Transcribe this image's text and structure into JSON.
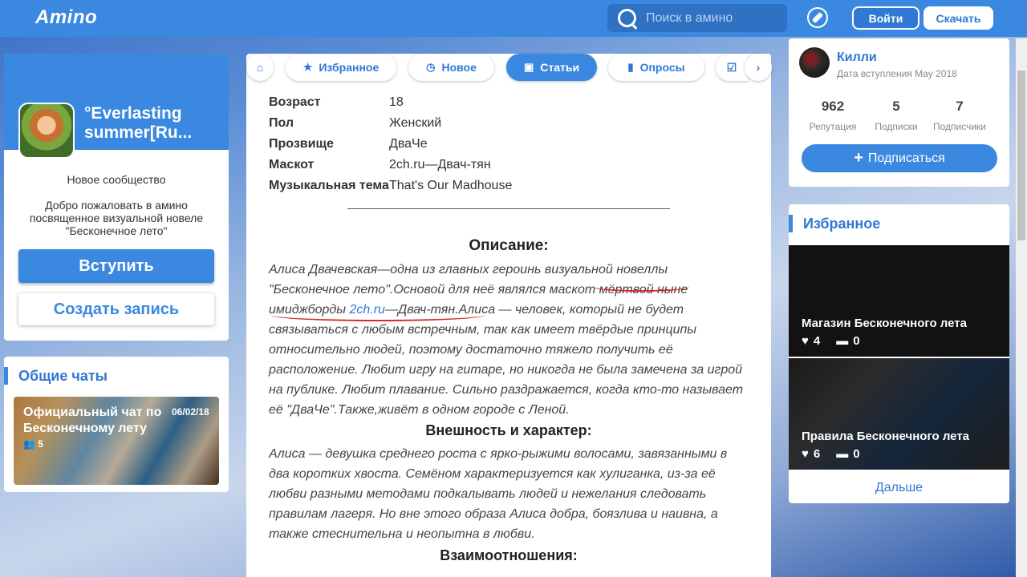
{
  "header": {
    "logo": "Amino",
    "search_placeholder": "Поиск в амино",
    "login": "Войти",
    "download": "Скачать"
  },
  "community": {
    "name": "°Everlasting summer[Ru...",
    "tag": "Новое сообщество",
    "description": "Добро пожаловать в амино посвященное визуальной новеле \"Бесконечное лето\"",
    "join": "Вступить",
    "create_post": "Создать запись"
  },
  "chats": {
    "title": "Общие чаты",
    "item": {
      "name": "Официальный чат по Бесконечному лету",
      "date": "06/02/18",
      "members": "5"
    }
  },
  "tabs": [
    {
      "label": "Избранное",
      "icon": "star-icon"
    },
    {
      "label": "Новое",
      "icon": "clock-icon"
    },
    {
      "label": "Статьи",
      "icon": "article-icon"
    },
    {
      "label": "Опросы",
      "icon": "poll-icon"
    }
  ],
  "article": {
    "info": [
      {
        "key": "Возраст",
        "value": "18"
      },
      {
        "key": "Пол",
        "value": "Женский"
      },
      {
        "key": "Прозвище",
        "value": "ДваЧе"
      },
      {
        "key": "Маскот",
        "value": "2ch.ru—Двач-тян"
      },
      {
        "key": "Музыкальная тема",
        "value": "That's Our Madhouse"
      }
    ],
    "h_desc": "Описание:",
    "desc_a": "Алиса Двачевская—одна из главных героинь визуальной новеллы \"Бесконечное лето\".Основой для неё являлся маскот мёртвой ныне имиджборды ",
    "desc_link": "2ch.ru",
    "desc_b": "—Двач-тян.Алиса — человек, который не будет связываться с любым встречным, так как имеет твёрдые принципы относительно людей, поэтому достаточно тяжело получить её расположение. Любит игру на гитаре, но никогда не была замечена за игрой на публике. Любит плавание. Сильно раздражается, когда кто-то называет её \"ДваЧе\".Также,живёт в одном городе с Леной.",
    "h_look": "Внешность и характер:",
    "look": "Алиса — девушка среднего роста с ярко-рыжими волосами, завязанными в два коротких хвоста. Семёном характеризуется как хулиганка, из-за её любви разными методами подкалывать людей и нежелания следовать правилам лагеря. Но вне этого образа Алиса добра, боязлива и наивна, а также стеснительна и неопытна в любви.",
    "h_rel": "Взаимоотношения:"
  },
  "profile": {
    "name": "Килли",
    "joined": "Дата вступления May 2018",
    "stats": [
      {
        "n": "962",
        "l": "Репутация"
      },
      {
        "n": "5",
        "l": "Подписки"
      },
      {
        "n": "7",
        "l": "Подписчики"
      }
    ],
    "subscribe": "Подписаться"
  },
  "featured": {
    "title": "Избранное",
    "items": [
      {
        "title": "Магазин Бесконечного лета",
        "likes": "4",
        "comments": "0"
      },
      {
        "title": "Правила Бесконечного лета",
        "likes": "6",
        "comments": "0"
      }
    ],
    "more": "Дальше"
  },
  "colors": {
    "accent": "#3a88e0"
  }
}
